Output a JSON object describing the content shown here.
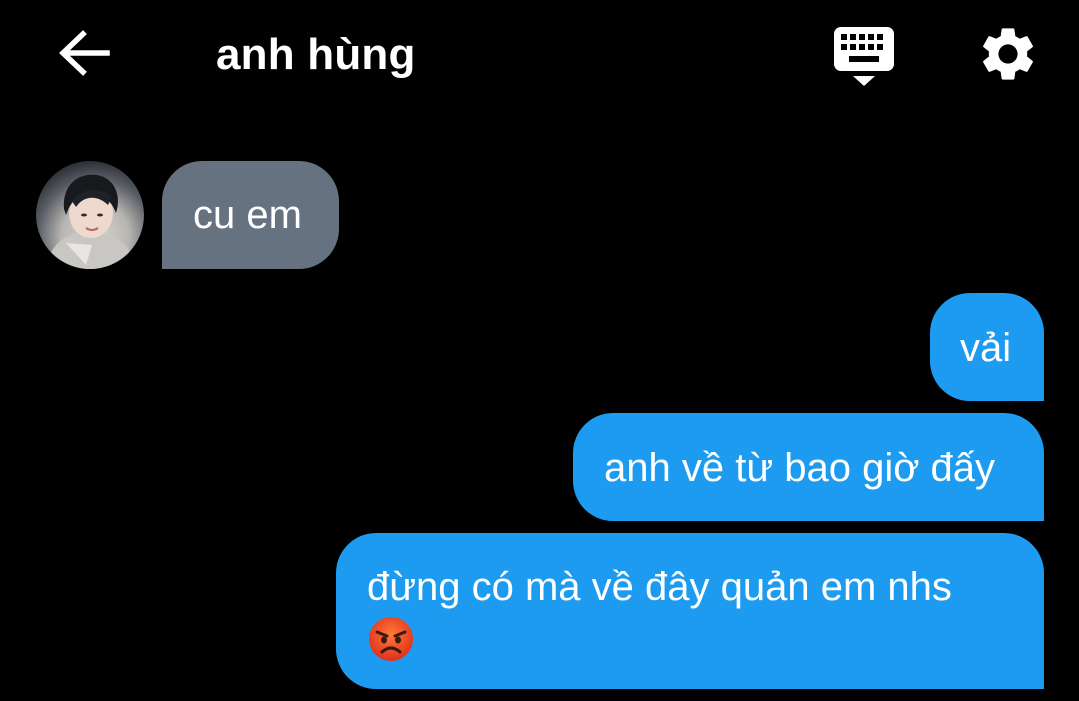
{
  "header": {
    "title": "anh hùng",
    "back_icon": "arrow-left-icon",
    "keyboard_icon": "keyboard-hide-icon",
    "settings_icon": "gear-icon"
  },
  "conversation": {
    "incoming_color": "#66727f",
    "outgoing_color": "#1d9bf0",
    "messages": [
      {
        "direction": "incoming",
        "text": "cu em"
      },
      {
        "direction": "outgoing",
        "text": "vải"
      },
      {
        "direction": "outgoing",
        "text": "anh về từ bao giờ đấy"
      },
      {
        "direction": "outgoing",
        "text": "đừng có mà về đây quản em nhs",
        "emoji": "angry-face-emoji"
      }
    ]
  }
}
